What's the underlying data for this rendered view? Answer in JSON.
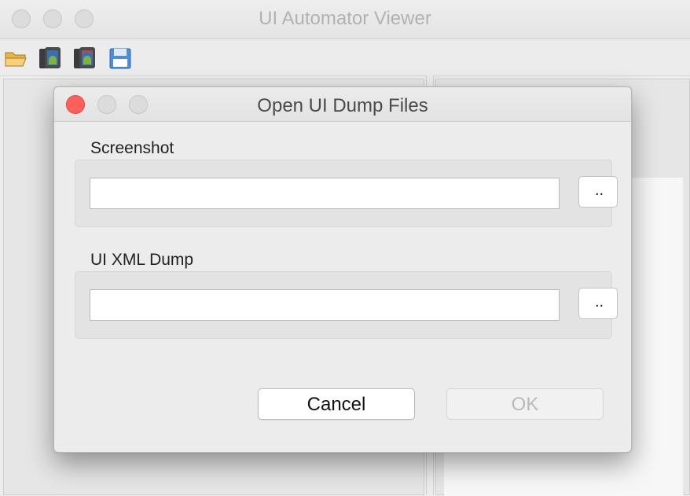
{
  "window": {
    "title": "UI Automator Viewer"
  },
  "toolbar": {
    "items": [
      {
        "icon": "open-folder-icon"
      },
      {
        "icon": "device-screenshot-icon"
      },
      {
        "icon": "device-screenshot-compressed-icon"
      },
      {
        "icon": "save-icon"
      }
    ]
  },
  "dialog": {
    "title": "Open UI Dump Files",
    "screenshot": {
      "label": "Screenshot",
      "value": "",
      "browse_label": ".."
    },
    "xml_dump": {
      "label": "UI XML Dump",
      "value": "",
      "browse_label": ".."
    },
    "cancel_label": "Cancel",
    "ok_label": "OK",
    "ok_enabled": false
  },
  "colors": {
    "close_button": "#fc605b",
    "disabled_text": "#b9b9b9"
  }
}
